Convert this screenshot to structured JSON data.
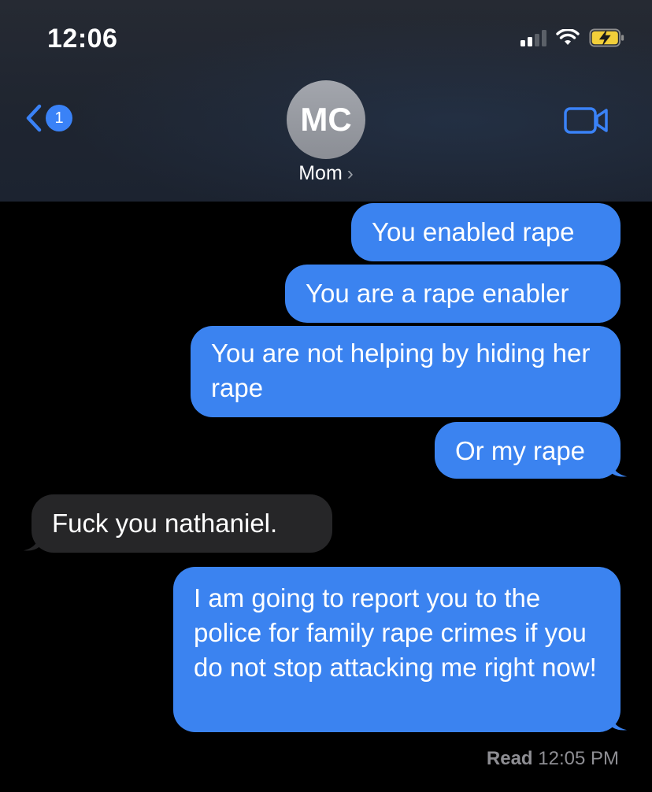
{
  "status_bar": {
    "time": "12:06"
  },
  "nav": {
    "back_badge": "1",
    "avatar_initials": "MC",
    "contact_name": "Mom"
  },
  "messages": [
    {
      "direction": "outgoing",
      "text": "You enabled rape"
    },
    {
      "direction": "outgoing",
      "text": "You are a rape enabler"
    },
    {
      "direction": "outgoing",
      "text": "You are not helping by hiding her rape"
    },
    {
      "direction": "outgoing",
      "text": "Or my rape"
    },
    {
      "direction": "incoming",
      "text": "Fuck you nathaniel."
    },
    {
      "direction": "outgoing",
      "text": "I am going to report you to the police for family rape crimes if you do not stop attacking me right now!"
    }
  ],
  "receipt": {
    "label": "Read",
    "time": "12:05 PM"
  },
  "colors": {
    "outgoing_bubble": "#3b83f0",
    "incoming_bubble": "#262628",
    "accent": "#3a82f7",
    "background": "#000000"
  },
  "icons": [
    "back-chevron-icon",
    "video-camera-icon",
    "signal-icon",
    "wifi-icon",
    "battery-charging-icon",
    "chevron-right-icon"
  ]
}
